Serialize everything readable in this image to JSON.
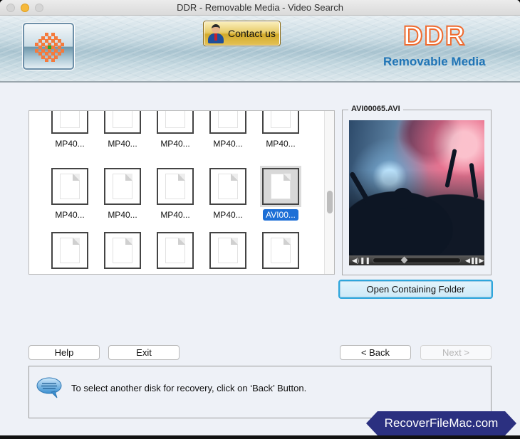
{
  "window": {
    "title": "DDR - Removable Media - Video Search"
  },
  "header": {
    "contact_label": "Contact us",
    "brand_name": "DDR",
    "brand_subtitle": "Removable Media",
    "colors": {
      "brand_orange": "#ef6a2e",
      "brand_blue": "#1f74b6",
      "logo_center": "#22a93a"
    }
  },
  "file_grid": {
    "rows": [
      [
        {
          "name": "MP40...",
          "selected": false
        },
        {
          "name": "MP40...",
          "selected": false
        },
        {
          "name": "MP40...",
          "selected": false
        },
        {
          "name": "MP40...",
          "selected": false
        },
        {
          "name": "MP40...",
          "selected": false
        }
      ],
      [
        {
          "name": "MP40...",
          "selected": false
        },
        {
          "name": "MP40...",
          "selected": false
        },
        {
          "name": "MP40...",
          "selected": false
        },
        {
          "name": "MP40...",
          "selected": false
        },
        {
          "name": "AVI00...",
          "selected": true
        }
      ],
      [
        {
          "name": "",
          "selected": false
        },
        {
          "name": "",
          "selected": false
        },
        {
          "name": "",
          "selected": false
        },
        {
          "name": "",
          "selected": false
        },
        {
          "name": "",
          "selected": false
        }
      ]
    ],
    "selection_color": "#1d6fd6"
  },
  "preview": {
    "title": "AVI00065.AVI",
    "player": {
      "volume_icon": "speaker-icon",
      "pause_icon": "pause-icon",
      "prev_icon": "step-back-icon",
      "next_icon": "step-forward-icon",
      "progress": 0.35
    },
    "open_folder_label": "Open Containing Folder"
  },
  "buttons": {
    "help": "Help",
    "exit": "Exit",
    "back": "< Back",
    "next": "Next >"
  },
  "message": {
    "text": "To select another disk for recovery, click on ‘Back’ Button."
  },
  "watermark": {
    "text": "RecoverFileMac.com"
  }
}
